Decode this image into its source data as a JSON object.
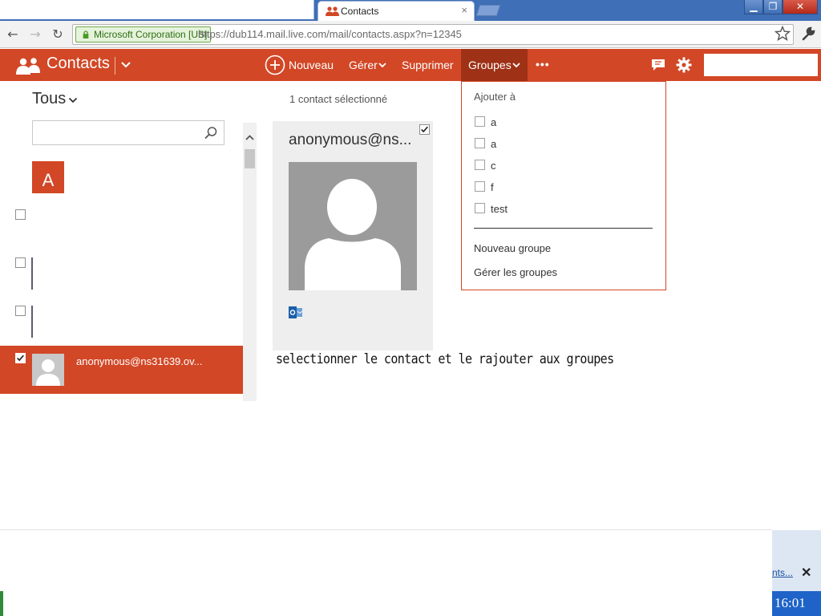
{
  "browser": {
    "tab_title": "Contacts",
    "tab_close": "×",
    "ev_label": "Microsoft Corporation [US]",
    "url": "https://dub114.mail.live.com/mail/contacts.aspx?n=12345"
  },
  "app": {
    "name": "Contacts",
    "commands": {
      "new": "Nouveau",
      "manage": "Gérer",
      "delete": "Supprimer",
      "groups": "Groupes",
      "more": "•••"
    },
    "colors": {
      "accent": "#d24726",
      "accent_dark": "#9e3116"
    }
  },
  "left_pane": {
    "filter": "Tous",
    "search": {
      "placeholder": "",
      "value": ""
    },
    "letter": "A",
    "selected_contact": "anonymous@ns31639.ov..."
  },
  "detail": {
    "selection_count": "1 contact sélectionné",
    "card_name": "anonymous@ns...",
    "caption": "selectionner le contact et le rajouter aux groupes"
  },
  "groups_menu": {
    "heading": "Ajouter à",
    "items": [
      "a",
      "a",
      "c",
      "f",
      "test"
    ],
    "new_group": "Nouveau groupe",
    "manage_groups": "Gérer les groupes"
  },
  "taskbar": {
    "notif_link": "nts...",
    "notif_close": "✕",
    "clock": "16:01"
  }
}
